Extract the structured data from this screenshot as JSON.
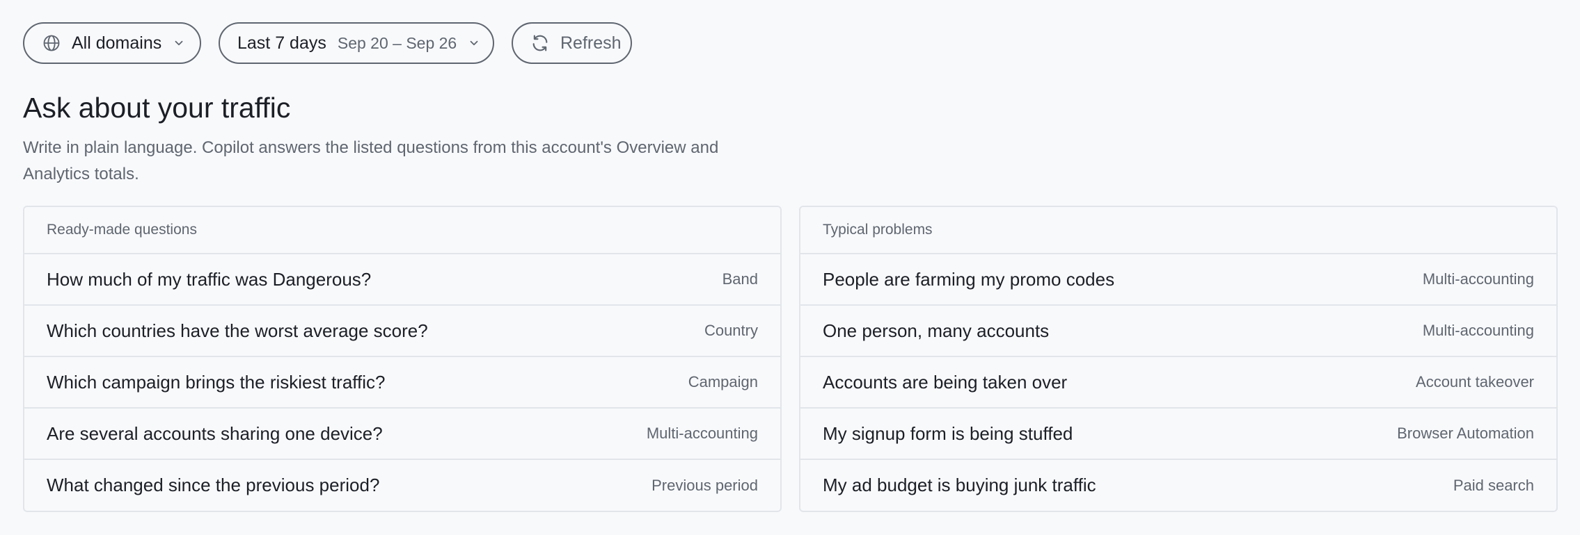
{
  "toolbar": {
    "domains_label": "All domains",
    "period_label": "Last 7 days",
    "period_range": "Sep 20 – Sep 26",
    "refresh_label": "Refresh"
  },
  "header": {
    "title": "Ask about your traffic",
    "subtitle": "Write in plain language. Copilot answers the listed questions from this account's Overview and Analytics totals."
  },
  "ready_made": {
    "heading": "Ready-made questions",
    "items": [
      {
        "question": "How much of my traffic was Dangerous?",
        "tag": "Band"
      },
      {
        "question": "Which countries have the worst average score?",
        "tag": "Country"
      },
      {
        "question": "Which campaign brings the riskiest traffic?",
        "tag": "Campaign"
      },
      {
        "question": "Are several accounts sharing one device?",
        "tag": "Multi-accounting"
      },
      {
        "question": "What changed since the previous period?",
        "tag": "Previous period"
      }
    ]
  },
  "typical": {
    "heading": "Typical problems",
    "items": [
      {
        "question": "People are farming my promo codes",
        "tag": "Multi-accounting"
      },
      {
        "question": "One person, many accounts",
        "tag": "Multi-accounting"
      },
      {
        "question": "Accounts are being taken over",
        "tag": "Account takeover"
      },
      {
        "question": "My signup form is being stuffed",
        "tag": "Browser Automation"
      },
      {
        "question": "My ad budget is buying junk traffic",
        "tag": "Paid search"
      }
    ]
  }
}
